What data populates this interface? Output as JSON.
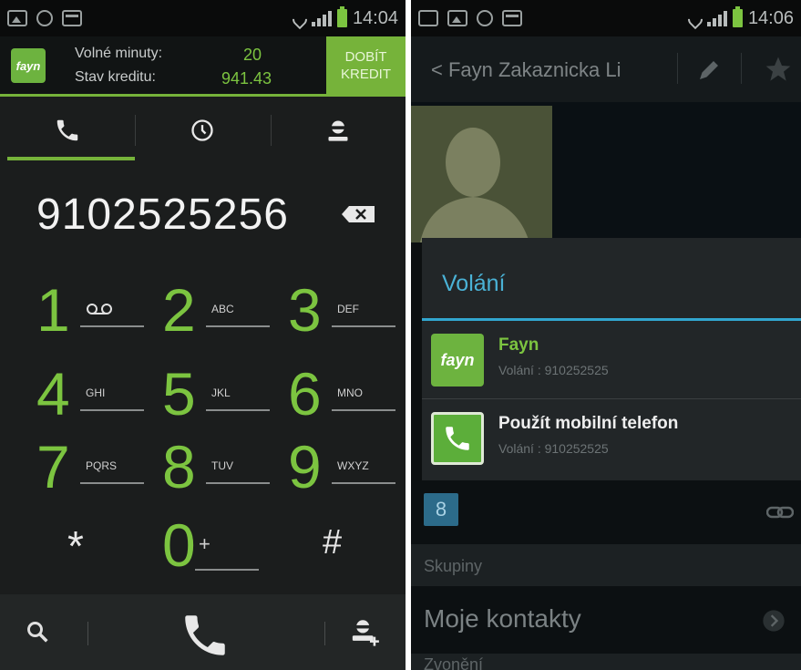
{
  "left_screen": {
    "status": {
      "time": "14:04"
    },
    "banner": {
      "logo_text": "fayn",
      "minutes_label": "Volné minuty:",
      "minutes_value": "20",
      "credit_label": "Stav kreditu:",
      "credit_value": "941.43",
      "topup_line1": "DOBÍT",
      "topup_line2": "KREDIT"
    },
    "tabs": [
      "phone-icon",
      "clock-icon",
      "contact-icon"
    ],
    "dialed_number": "9102525256",
    "keys": [
      {
        "digit": "1",
        "letters": ""
      },
      {
        "digit": "2",
        "letters": "ABC"
      },
      {
        "digit": "3",
        "letters": "DEF"
      },
      {
        "digit": "4",
        "letters": "GHI"
      },
      {
        "digit": "5",
        "letters": "JKL"
      },
      {
        "digit": "6",
        "letters": "MNO"
      },
      {
        "digit": "7",
        "letters": "PQRS"
      },
      {
        "digit": "8",
        "letters": "TUV"
      },
      {
        "digit": "9",
        "letters": "WXYZ"
      },
      {
        "digit": "*",
        "letters": ""
      },
      {
        "digit": "0",
        "letters": "+"
      },
      {
        "digit": "#",
        "letters": ""
      }
    ]
  },
  "right_screen": {
    "status": {
      "time": "14:06"
    },
    "actionbar": {
      "title": "Fayn Zakaznicka Li"
    },
    "dialog": {
      "title": "Volání",
      "options": [
        {
          "name": "Fayn",
          "sub": "Volání : 910252525",
          "logo_text": "fayn"
        },
        {
          "name": "Použít mobilní telefon",
          "sub": "Volání : 910252525"
        }
      ]
    },
    "google_icon": "8",
    "section_groups": "Skupiny",
    "my_contacts": "Moje kontakty",
    "section_next": "Zvonění"
  },
  "colors": {
    "accent_green": "#76b33a",
    "digit_green": "#7cc440",
    "dialog_blue": "#32a6cf"
  }
}
